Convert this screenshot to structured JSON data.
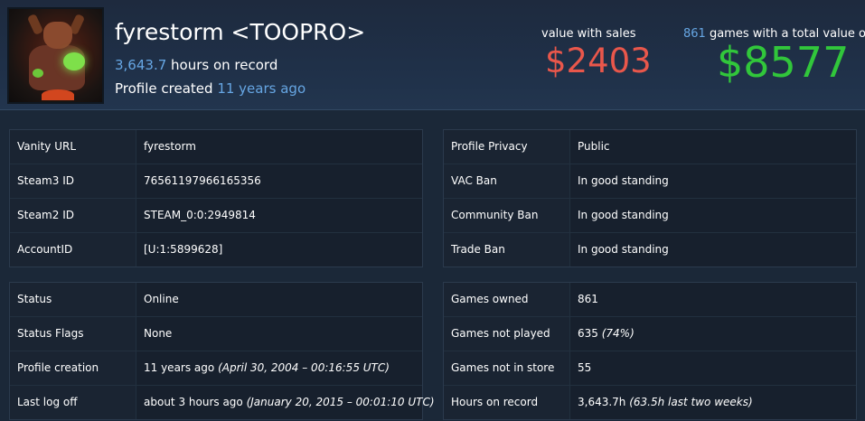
{
  "profile": {
    "name": "fyrestorm <TOOPRO>",
    "hours_value": "3,643.7",
    "hours_suffix": " hours on record",
    "created_prefix": "Profile created ",
    "created_value": "11 years ago"
  },
  "value": {
    "sales_label": "value with sales",
    "sales_amount": "$2403",
    "games_count": "861",
    "total_label_suffix": " games with a total value of",
    "total_amount": "$8577"
  },
  "colors": {
    "accent_blue": "#66a6e3",
    "sales_red": "#e9574b",
    "total_green": "#31c63b",
    "background": "#1b2838"
  },
  "panels": {
    "ids": [
      {
        "key": "Vanity URL",
        "value": "fyrestorm"
      },
      {
        "key": "Steam3 ID",
        "value": "76561197966165356"
      },
      {
        "key": "Steam2 ID",
        "value": "STEAM_0:0:2949814"
      },
      {
        "key": "AccountID",
        "value": "[U:1:5899628]"
      }
    ],
    "bans": [
      {
        "key": "Profile Privacy",
        "value": "Public"
      },
      {
        "key": "VAC Ban",
        "value": "In good standing"
      },
      {
        "key": "Community Ban",
        "value": "In good standing"
      },
      {
        "key": "Trade Ban",
        "value": "In good standing"
      }
    ],
    "status": [
      {
        "key": "Status",
        "value": "Online",
        "extra": ""
      },
      {
        "key": "Status Flags",
        "value": "None",
        "extra": ""
      },
      {
        "key": "Profile creation",
        "value": "11 years ago ",
        "extra": "(April 30, 2004 – 00:16:55 UTC)"
      },
      {
        "key": "Last log off",
        "value": "about 3 hours ago ",
        "extra": "(January 20, 2015 – 00:01:10 UTC)"
      }
    ],
    "games": [
      {
        "key": "Games owned",
        "value": "861",
        "extra": ""
      },
      {
        "key": "Games not played",
        "value": "635 ",
        "extra": "(74%)"
      },
      {
        "key": "Games not in store",
        "value": "55",
        "extra": ""
      },
      {
        "key": "Hours on record",
        "value": "3,643.7h ",
        "extra": "(63.5h last two weeks)"
      }
    ]
  }
}
